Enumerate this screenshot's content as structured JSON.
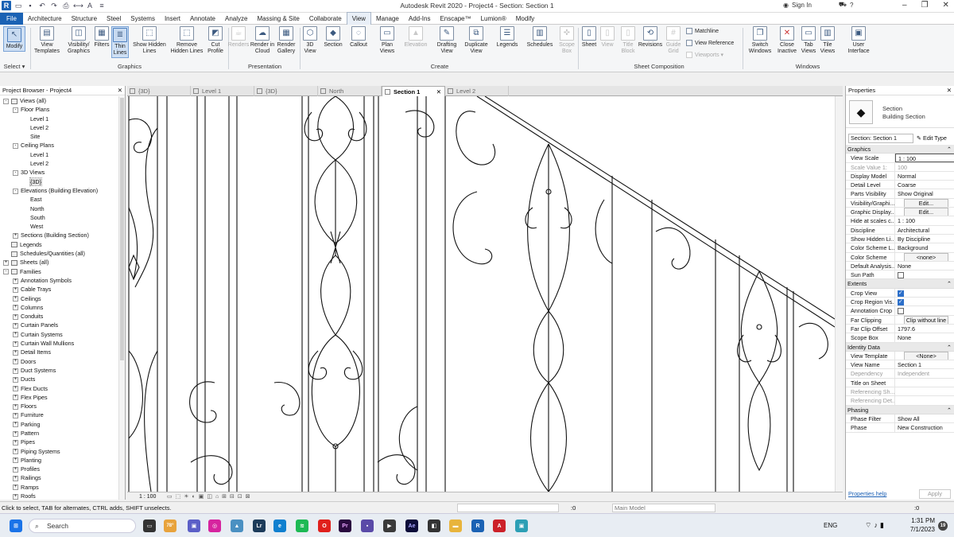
{
  "window": {
    "title": "Autodesk Revit 2020 - Project4 - Section: Section 1",
    "sign_in": "Sign In"
  },
  "menu_tabs": [
    "File",
    "Architecture",
    "Structure",
    "Steel",
    "Systems",
    "Insert",
    "Annotate",
    "Analyze",
    "Massing & Site",
    "Collaborate",
    "View",
    "Manage",
    "Add-Ins",
    "Enscape™",
    "Lumion®",
    "Modify"
  ],
  "ribbon": {
    "modify": "Modify",
    "select": "Select ▾",
    "graphics": {
      "panel": "Graphics",
      "view_templates": "View Templates",
      "visibility": "Visibility/ Graphics",
      "filters": "Filters",
      "thin_lines": "Thin Lines",
      "show_hidden": "Show Hidden Lines",
      "remove_hidden": "Remove Hidden Lines",
      "cut_profile": "Cut Profile"
    },
    "presentation": {
      "panel": "Presentation",
      "renders": "Renders",
      "render_cloud": "Render in Cloud",
      "render_gallery": "Render Gallery"
    },
    "create": {
      "panel": "Create",
      "view3d": "3D View",
      "section": "Section",
      "callout": "Callout",
      "plan_views": "Plan Views",
      "elevation": "Elevation",
      "drafting": "Drafting View",
      "duplicate": "Duplicate View",
      "legends": "Legends",
      "schedules": "Schedules",
      "scope_box": "Scope Box"
    },
    "sheet": {
      "panel": "Sheet Composition",
      "sheet": "Sheet",
      "view": "View",
      "title_block": "Title Block",
      "revisions": "Revisions",
      "guide_grid": "Guide Grid",
      "matchline": "Matchline",
      "view_reference": "View Reference",
      "viewports": "Viewports ▾"
    },
    "windows": {
      "panel": "Windows",
      "switch": "Switch Windows",
      "close_inactive": "Close Inactive",
      "tab_views": "Tab Views",
      "tile_views": "Tile Views",
      "user_interface": "User Interface"
    }
  },
  "project_browser": {
    "title": "Project Browser - Project4",
    "items": [
      {
        "label": "Views (all)",
        "level": 0,
        "exp": "-",
        "icon": "views-icon"
      },
      {
        "label": "Floor Plans",
        "level": 1,
        "exp": "-"
      },
      {
        "label": "Level 1",
        "level": 2
      },
      {
        "label": "Level 2",
        "level": 2
      },
      {
        "label": "Site",
        "level": 2
      },
      {
        "label": "Ceiling Plans",
        "level": 1,
        "exp": "-"
      },
      {
        "label": "Level 1",
        "level": 2
      },
      {
        "label": "Level 2",
        "level": 2
      },
      {
        "label": "3D Views",
        "level": 1,
        "exp": "-"
      },
      {
        "label": "{3D}",
        "level": 2,
        "selected": true
      },
      {
        "label": "Elevations (Building Elevation)",
        "level": 1,
        "exp": "-"
      },
      {
        "label": "East",
        "level": 2
      },
      {
        "label": "North",
        "level": 2
      },
      {
        "label": "South",
        "level": 2
      },
      {
        "label": "West",
        "level": 2
      },
      {
        "label": "Sections (Building Section)",
        "level": 1,
        "exp": "+"
      },
      {
        "label": "Legends",
        "level": 0,
        "icon": "legends-icon"
      },
      {
        "label": "Schedules/Quantities (all)",
        "level": 0,
        "icon": "schedules-icon"
      },
      {
        "label": "Sheets (all)",
        "level": 0,
        "exp": "+",
        "icon": "sheets-icon"
      },
      {
        "label": "Families",
        "level": 0,
        "exp": "-",
        "icon": "families-icon"
      },
      {
        "label": "Annotation Symbols",
        "level": 1,
        "exp": "+"
      },
      {
        "label": "Cable Trays",
        "level": 1,
        "exp": "+"
      },
      {
        "label": "Ceilings",
        "level": 1,
        "exp": "+"
      },
      {
        "label": "Columns",
        "level": 1,
        "exp": "+"
      },
      {
        "label": "Conduits",
        "level": 1,
        "exp": "+"
      },
      {
        "label": "Curtain Panels",
        "level": 1,
        "exp": "+"
      },
      {
        "label": "Curtain Systems",
        "level": 1,
        "exp": "+"
      },
      {
        "label": "Curtain Wall Mullions",
        "level": 1,
        "exp": "+"
      },
      {
        "label": "Detail Items",
        "level": 1,
        "exp": "+"
      },
      {
        "label": "Doors",
        "level": 1,
        "exp": "+"
      },
      {
        "label": "Duct Systems",
        "level": 1,
        "exp": "+"
      },
      {
        "label": "Ducts",
        "level": 1,
        "exp": "+"
      },
      {
        "label": "Flex Ducts",
        "level": 1,
        "exp": "+"
      },
      {
        "label": "Flex Pipes",
        "level": 1,
        "exp": "+"
      },
      {
        "label": "Floors",
        "level": 1,
        "exp": "+"
      },
      {
        "label": "Furniture",
        "level": 1,
        "exp": "+"
      },
      {
        "label": "Parking",
        "level": 1,
        "exp": "+"
      },
      {
        "label": "Pattern",
        "level": 1,
        "exp": "+"
      },
      {
        "label": "Pipes",
        "level": 1,
        "exp": "+"
      },
      {
        "label": "Piping Systems",
        "level": 1,
        "exp": "+"
      },
      {
        "label": "Planting",
        "level": 1,
        "exp": "+"
      },
      {
        "label": "Profiles",
        "level": 1,
        "exp": "+"
      },
      {
        "label": "Railings",
        "level": 1,
        "exp": "+"
      },
      {
        "label": "Ramps",
        "level": 1,
        "exp": "+"
      },
      {
        "label": "Roofs",
        "level": 1,
        "exp": "+"
      }
    ]
  },
  "view_tabs": [
    {
      "label": "{3D}"
    },
    {
      "label": "Level 1"
    },
    {
      "label": "{3D}"
    },
    {
      "label": "North"
    },
    {
      "label": "Section 1",
      "active": true
    },
    {
      "label": "Level 2"
    }
  ],
  "view_control": {
    "scale": "1 : 100"
  },
  "properties": {
    "title": "Properties",
    "type_name": "Section",
    "type_sub": "Building Section",
    "instance": "Section: Section 1",
    "edit_type": "Edit Type",
    "groups": [
      {
        "name": "Graphics",
        "rows": [
          {
            "k": "View Scale",
            "v": "1 : 100",
            "box": true
          },
          {
            "k": "Scale Value    1:",
            "v": "100",
            "gray": true
          },
          {
            "k": "Display Model",
            "v": "Normal"
          },
          {
            "k": "Detail Level",
            "v": "Coarse"
          },
          {
            "k": "Parts Visibility",
            "v": "Show Original"
          },
          {
            "k": "Visibility/Graphi...",
            "v": "Edit...",
            "btn": true
          },
          {
            "k": "Graphic Display...",
            "v": "Edit...",
            "btn": true
          },
          {
            "k": "Hide at scales c...",
            "v": "1 : 100"
          },
          {
            "k": "Discipline",
            "v": "Architectural"
          },
          {
            "k": "Show Hidden Li...",
            "v": "By Discipline"
          },
          {
            "k": "Color Scheme L...",
            "v": "Background"
          },
          {
            "k": "Color Scheme",
            "v": "<none>",
            "btn": true
          },
          {
            "k": "Default Analysis...",
            "v": "None"
          },
          {
            "k": "Sun Path",
            "v": "",
            "chk": "off"
          }
        ]
      },
      {
        "name": "Extents",
        "rows": [
          {
            "k": "Crop View",
            "v": "",
            "chk": "on"
          },
          {
            "k": "Crop Region Vis...",
            "v": "",
            "chk": "on"
          },
          {
            "k": "Annotation Crop",
            "v": "",
            "chk": "off"
          },
          {
            "k": "Far Clipping",
            "v": "Clip without line",
            "btn": true
          },
          {
            "k": "Far Clip Offset",
            "v": "1797.6"
          },
          {
            "k": "Scope Box",
            "v": "None"
          }
        ]
      },
      {
        "name": "Identity Data",
        "rows": [
          {
            "k": "View Template",
            "v": "<None>",
            "btn": true
          },
          {
            "k": "View Name",
            "v": "Section 1"
          },
          {
            "k": "Dependency",
            "v": "Independent",
            "gray": true
          },
          {
            "k": "Title on Sheet",
            "v": ""
          },
          {
            "k": "Referencing Sh...",
            "v": "",
            "gray": true
          },
          {
            "k": "Referencing Det...",
            "v": "",
            "gray": true
          }
        ]
      },
      {
        "name": "Phasing",
        "rows": [
          {
            "k": "Phase Filter",
            "v": "Show All"
          },
          {
            "k": "Phase",
            "v": "New Construction"
          }
        ]
      }
    ],
    "help": "Properties help",
    "apply": "Apply"
  },
  "status": {
    "text": "Click to select, TAB for alternates, CTRL adds, SHIFT unselects.",
    "zero": ":0",
    "model": "Main Model",
    "filter": ":0"
  },
  "taskbar": {
    "search": "Search",
    "weather": "78°",
    "time": "1:31 PM",
    "date": "7/1/2023",
    "lang": "ENG"
  }
}
